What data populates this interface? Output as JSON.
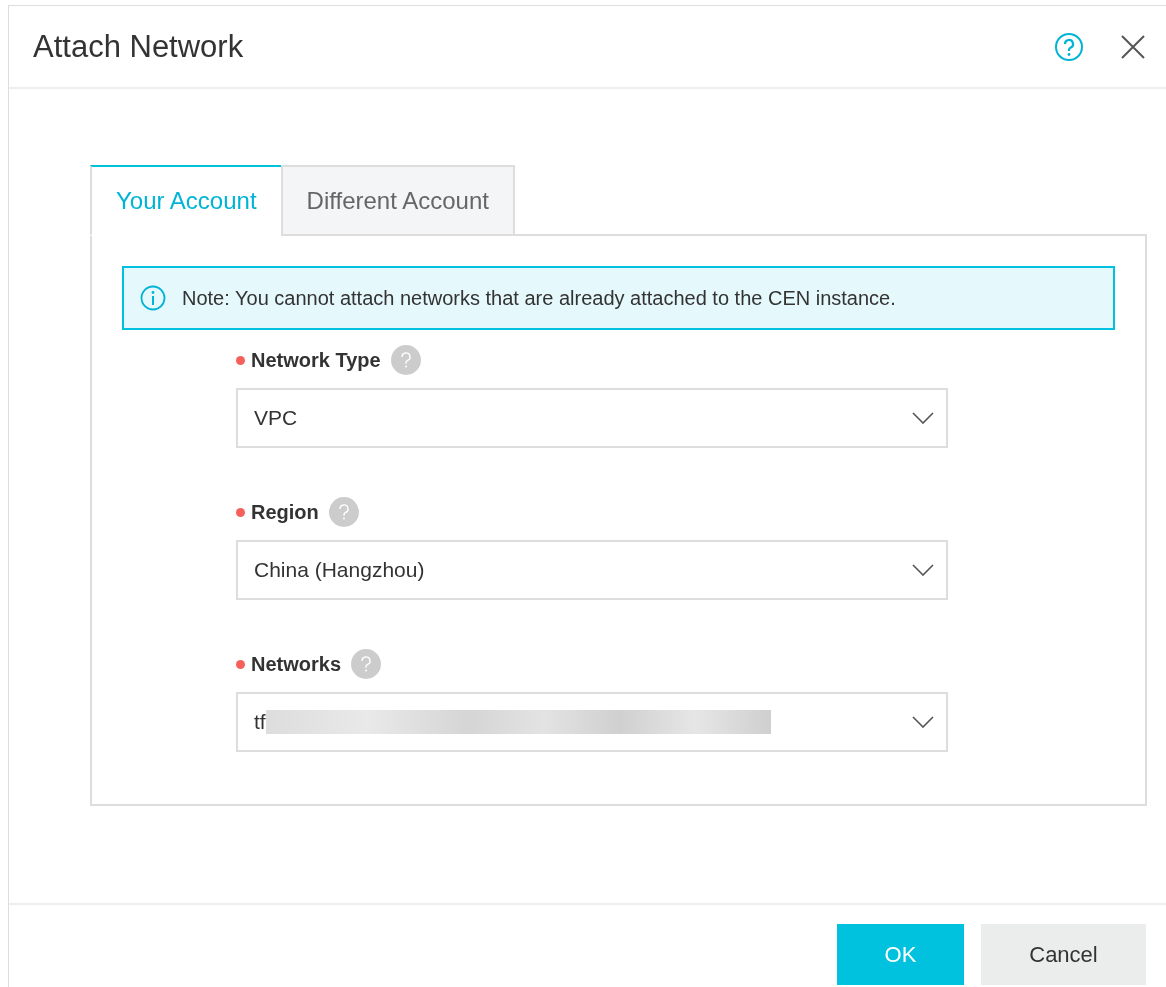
{
  "dialog": {
    "title": "Attach Network"
  },
  "tabs": [
    {
      "label": "Your Account",
      "selected": true
    },
    {
      "label": "Different Account",
      "selected": false
    }
  ],
  "note": "Note: You cannot attach networks that are already attached to the CEN instance.",
  "fields": [
    {
      "label": "Network Type",
      "required": true,
      "value": "VPC"
    },
    {
      "label": "Region",
      "required": true,
      "value": "China (Hangzhou)"
    },
    {
      "label": "Networks",
      "required": true,
      "value": "tf",
      "redacted": true
    }
  ],
  "buttons": [
    {
      "label": "OK",
      "kind": "primary"
    },
    {
      "label": "Cancel",
      "kind": "secondary"
    }
  ]
}
